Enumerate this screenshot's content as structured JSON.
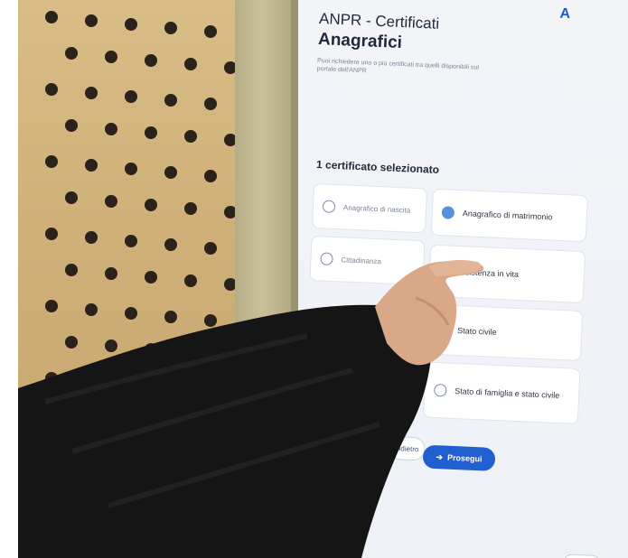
{
  "screen": {
    "logo": "A",
    "title_line1": "ANPR - Certificati",
    "title_line2": "Anagrafici",
    "subtitle": "Puoi richiedere uno o più certificati tra quelli disponibili sul portale dell'ANPR",
    "selected_count": "1 certificato selezionato",
    "options": [
      {
        "label": "Anagrafico di nascita",
        "selected": false
      },
      {
        "label": "Anagrafico di matrimonio",
        "selected": true
      },
      {
        "label": "Cittadinanza",
        "selected": false
      },
      {
        "label": "Esistenza in vita",
        "selected": false
      },
      {
        "label": "Stato civile",
        "selected": false
      },
      {
        "label": "Stato di famiglia e stato civile",
        "selected": false
      }
    ],
    "back_label": "Indietro",
    "next_label": "Prosegui",
    "next_icon": "arrow-right-icon"
  },
  "colors": {
    "accent": "#1f5fd0",
    "radio_selected": "#5a8fe0",
    "wood": "#d4b47d",
    "sleeve": "#151515"
  }
}
